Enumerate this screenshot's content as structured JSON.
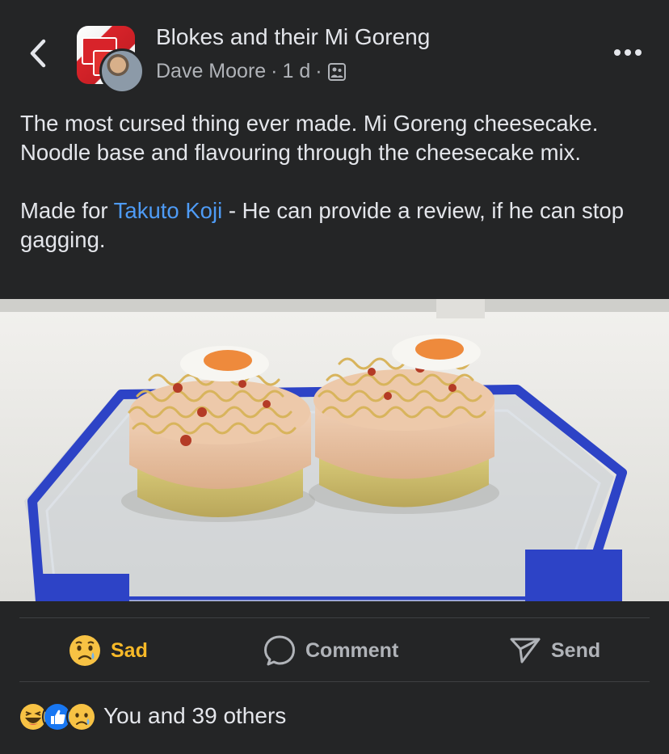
{
  "header": {
    "back_icon": "chevron-left-icon",
    "group_name": "Blokes and their Mi Goreng",
    "author": "Dave Moore",
    "time": "1 d",
    "separator": "·",
    "audience_icon": "group-audience-icon",
    "more_icon": "more-horizontal-icon"
  },
  "post": {
    "paragraph1": "The most cursed thing ever made. Mi Goreng cheesecake. Noodle base and flavouring through the cheesecake mix.",
    "p2_before": "Made for ",
    "p2_mention": "Takuto Koji",
    "p2_after": " - He can provide a review, if he can stop gagging."
  },
  "photo": {
    "icon": "photo-image"
  },
  "actions": {
    "sad_label": "Sad",
    "sad_icon": "sad-emoji-icon",
    "comment_label": "Comment",
    "comment_icon": "comment-bubble-icon",
    "send_label": "Send",
    "send_icon": "send-icon"
  },
  "reactions": {
    "icons": [
      "haha-emoji-icon",
      "like-icon",
      "sad-emoji-icon"
    ],
    "summary": "You and 39 others"
  },
  "colors": {
    "background": "#242526",
    "text": "#e4e6eb",
    "secondary": "#b0b3b8",
    "mention": "#4e9bf5",
    "sad": "#f7b928"
  }
}
